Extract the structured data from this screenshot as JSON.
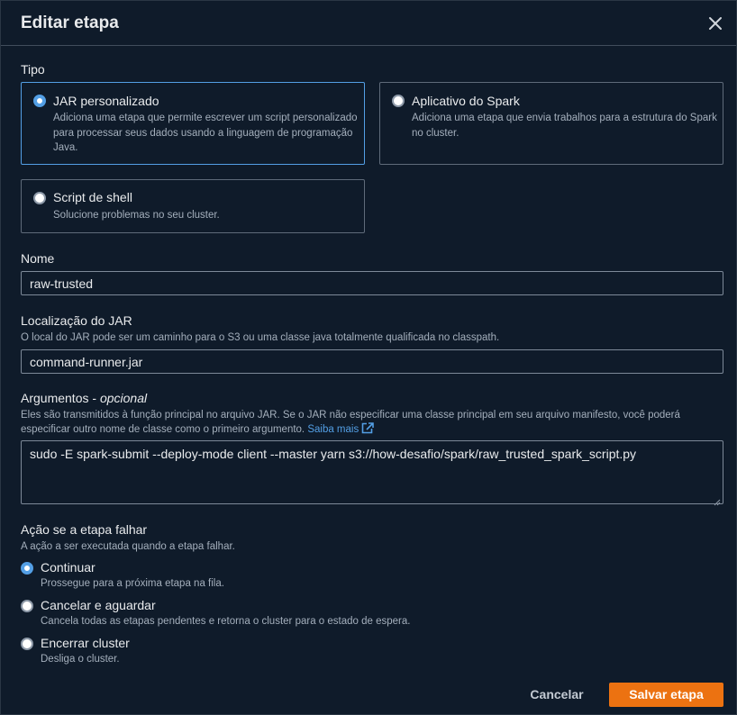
{
  "modal": {
    "title": "Editar etapa"
  },
  "tipo": {
    "label": "Tipo",
    "options": [
      {
        "title": "JAR personalizado",
        "description": "Adiciona uma etapa que permite escrever um script personalizado para processar seus dados usando a linguagem de programação Java.",
        "selected": true
      },
      {
        "title": "Aplicativo do Spark",
        "description": "Adiciona uma etapa que envia trabalhos para a estrutura do Spark no cluster.",
        "selected": false
      },
      {
        "title": "Script de shell",
        "description": "Solucione problemas no seu cluster.",
        "selected": false
      }
    ]
  },
  "nome": {
    "label": "Nome",
    "value": "raw-trusted"
  },
  "jar": {
    "label": "Localização do JAR",
    "description": "O local do JAR pode ser um caminho para o S3 ou uma classe java totalmente qualificada no classpath.",
    "value": "command-runner.jar"
  },
  "argumentos": {
    "label": "Argumentos - ",
    "label_optional": "opcional",
    "description_line1": "Eles são transmitidos à função principal no arquivo JAR. Se o JAR não especificar uma classe principal em seu arquivo manifesto, você poderá",
    "description_line2": "especificar outro nome de classe como o primeiro argumento.",
    "learn_more": "Saiba mais",
    "value": "sudo -E spark-submit --deploy-mode client --master yarn s3://how-desafio/spark/raw_trusted_spark_script.py"
  },
  "falha": {
    "label": "Ação se a etapa falhar",
    "description": "A ação a ser executada quando a etapa falhar.",
    "options": [
      {
        "title": "Continuar",
        "description": "Prossegue para a próxima etapa na fila.",
        "selected": true
      },
      {
        "title": "Cancelar e aguardar",
        "description": "Cancela todas as etapas pendentes e retorna o cluster para o estado de espera.",
        "selected": false
      },
      {
        "title": "Encerrar cluster",
        "description": "Desliga o cluster.",
        "selected": false
      }
    ]
  },
  "footer": {
    "cancel_label": "Cancelar",
    "save_label": "Salvar etapa"
  },
  "colors": {
    "accent": "#539fe5",
    "primary_button": "#ec7211",
    "background": "#0f1b2a"
  }
}
